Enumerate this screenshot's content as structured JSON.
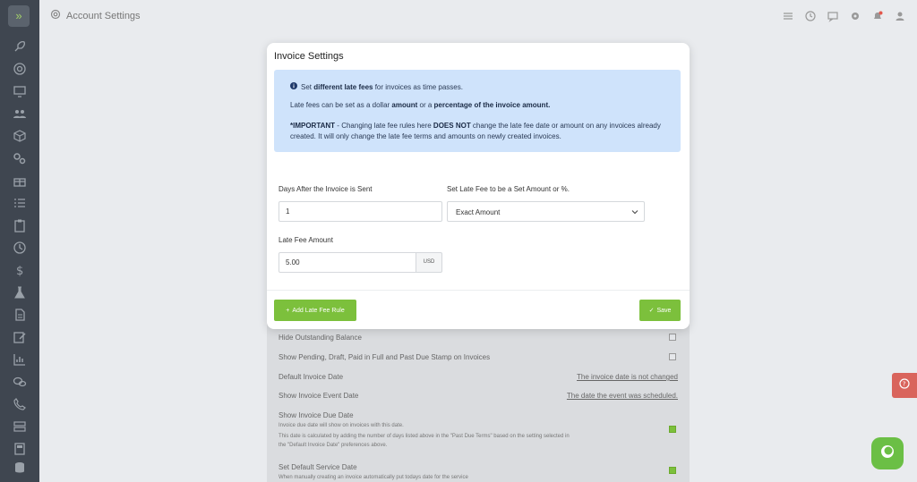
{
  "page": {
    "title": "Account Settings"
  },
  "modal": {
    "title": "Invoice Settings",
    "info": {
      "line1_prefix": "Set ",
      "line1_bold": "different late fees",
      "line1_suffix": " for invoices as time passes.",
      "line2_prefix": "Late fees can be set as a dollar ",
      "line2_bold1": "amount",
      "line2_mid": " or a ",
      "line2_bold2": "percentage of the invoice amount.",
      "line3_bold1": "*IMPORTANT",
      "line3_mid": " - Changing late fee rules here ",
      "line3_bold2": "DOES NOT",
      "line3_suffix": " change the late fee date or amount on any invoices already created. It will only change the late fee terms and amounts on newly created invoices."
    },
    "days_label": "Days After the Invoice is Sent",
    "days_value": "1",
    "type_label": "Set Late Fee to be a Set Amount or %.",
    "type_value": "Exact Amount",
    "amount_label": "Late Fee Amount",
    "amount_value": "5.00",
    "currency": "USD",
    "add_rule_label": "Add Late Fee Rule",
    "save_label": "Save"
  },
  "background": {
    "rows": [
      {
        "label": "Hide Outstanding Balance"
      },
      {
        "label": "Show Pending, Draft, Paid in Full and Past Due Stamp on Invoices"
      },
      {
        "label": "Default Invoice Date",
        "value": "The invoice date is not changed"
      },
      {
        "label": "Show Invoice Event Date",
        "value": "The date the event was scheduled."
      },
      {
        "label": "Show Invoice Due Date"
      },
      {
        "label": "Set Default Service Date"
      }
    ],
    "due_date_desc1": "Invoice due date will show on invoices with this date.",
    "due_date_desc2": "This date is calculated by adding the number of days listed above in the \"Past Due Terms\" based on the setting selected in the \"Default Invoice Date\" preferences above.",
    "service_date_desc": "When manually creating an invoice automatically put todays date for the service"
  },
  "colors": {
    "accent": "#7cc03c",
    "sidebar": "#3f4650",
    "info_bg": "#cfe3fb",
    "help": "#d9645c"
  }
}
